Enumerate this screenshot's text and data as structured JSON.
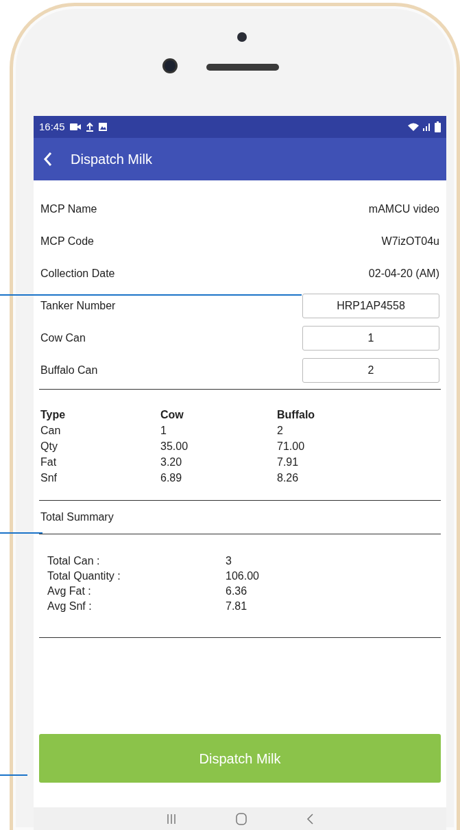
{
  "status_bar": {
    "time": "16:45"
  },
  "app_bar": {
    "title": "Dispatch Milk"
  },
  "fields": [
    {
      "kind": "text",
      "label": "MCP Name",
      "value": "mAMCU video"
    },
    {
      "kind": "text",
      "label": "MCP Code",
      "value": "W7izOT04u"
    },
    {
      "kind": "text",
      "label": "Collection Date",
      "value": "02-04-20 (AM)"
    },
    {
      "kind": "input",
      "label": "Tanker Number",
      "value": "HRP1AP4558"
    },
    {
      "kind": "input",
      "label": "Cow Can",
      "value": "1"
    },
    {
      "kind": "input",
      "label": "Buffalo Can",
      "value": "2"
    }
  ],
  "table": {
    "columns": [
      "Type",
      "Cow",
      "Buffalo"
    ],
    "rows": [
      [
        "Can",
        "1",
        "2"
      ],
      [
        "Qty",
        "35.00",
        "71.00"
      ],
      [
        "Fat",
        "3.20",
        "7.91"
      ],
      [
        "Snf",
        "6.89",
        "8.26"
      ]
    ]
  },
  "summary": {
    "title": "Total Summary",
    "items": [
      {
        "label": "Total Can :",
        "value": "3"
      },
      {
        "label": "Total Quantity :",
        "value": "106.00"
      },
      {
        "label": "Avg Fat :",
        "value": "6.36"
      },
      {
        "label": "Avg Snf :",
        "value": "7.81"
      }
    ]
  },
  "button": "Dispatch Milk"
}
